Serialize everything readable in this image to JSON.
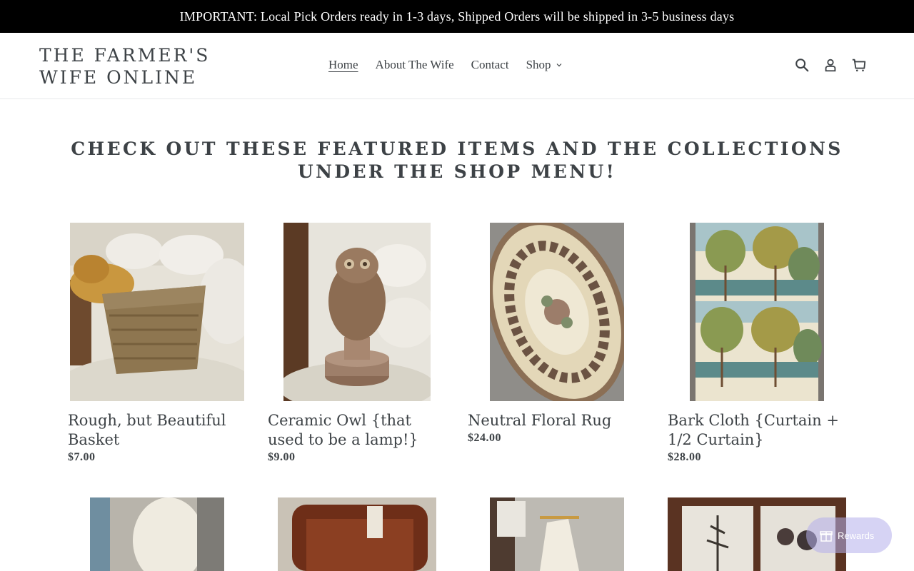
{
  "announcement": {
    "text": "IMPORTANT: Local Pick Orders ready in 1-3 days, Shipped Orders will be shipped in 3-5 business days"
  },
  "header": {
    "logo_line1": "THE FARMER'S",
    "logo_line2": "WIFE ONLINE",
    "nav": [
      {
        "label": "Home",
        "active": true
      },
      {
        "label": "About The Wife"
      },
      {
        "label": "Contact"
      },
      {
        "label": "Shop",
        "has_dropdown": true
      }
    ],
    "icons": [
      "search-icon",
      "account-icon",
      "cart-icon"
    ]
  },
  "featured": {
    "title": "CHECK OUT THESE FEATURED ITEMS AND THE COLLECTIONS UNDER THE SHOP MENU!",
    "products": [
      {
        "title": "Rough, but Beautiful Basket",
        "price": "$7.00"
      },
      {
        "title": "Ceramic Owl {that used to be a lamp!}",
        "price": "$9.00"
      },
      {
        "title": "Neutral Floral Rug",
        "price": "$24.00"
      },
      {
        "title": "Bark Cloth {Curtain + 1/2 Curtain}",
        "price": "$28.00"
      }
    ]
  },
  "rewards": {
    "label": "Rewards"
  },
  "colors": {
    "announcement_bg": "#000000",
    "text": "#3d4246",
    "rewards_bg": "#b4afeb"
  }
}
